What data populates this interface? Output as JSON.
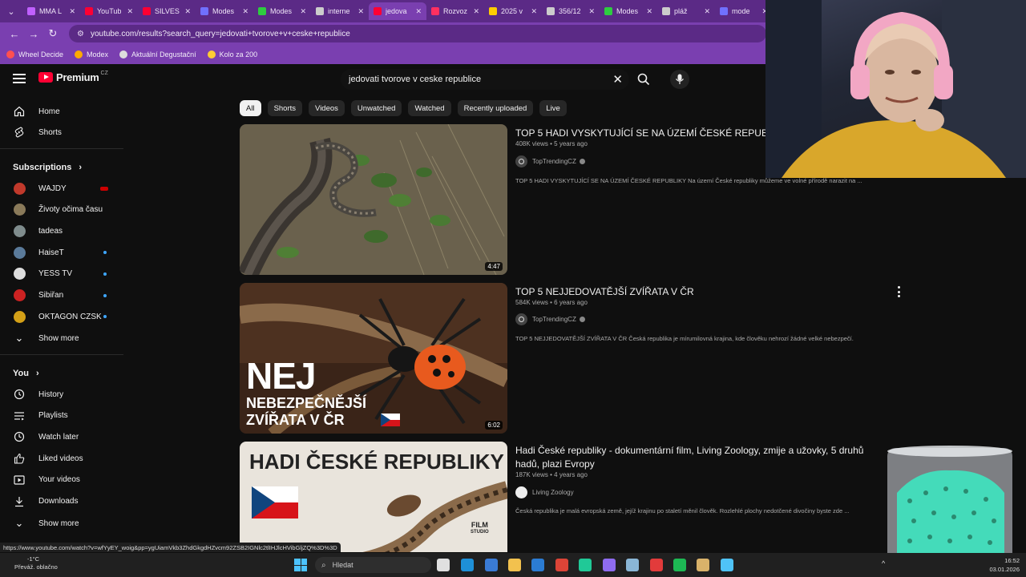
{
  "browser": {
    "tabs": [
      {
        "label": "MMA L",
        "color": "#c060ff"
      },
      {
        "label": "YouTub",
        "color": "#ff0033"
      },
      {
        "label": "SILVES",
        "color": "#ff0033"
      },
      {
        "label": "Modes",
        "color": "#7070ff"
      },
      {
        "label": "Modes",
        "color": "#2ecc40"
      },
      {
        "label": "interne",
        "color": "#cccccc"
      },
      {
        "label": "jedova",
        "color": "#ff0033",
        "active": true
      },
      {
        "label": "Rozvoz",
        "color": "#ff3060"
      },
      {
        "label": "2025 v",
        "color": "#ffcc00"
      },
      {
        "label": "356/12",
        "color": "#cccccc"
      },
      {
        "label": "Modes",
        "color": "#2ecc40"
      },
      {
        "label": "pláž",
        "color": "#cccccc"
      },
      {
        "label": "mode",
        "color": "#7070ff"
      }
    ],
    "url": "youtube.com/results?search_query=jedovati+tvorove+v+ceske+republice",
    "bookmarks": [
      {
        "label": "Wheel Decide",
        "color": "#ff5050"
      },
      {
        "label": "Modex",
        "color": "#ffaa00"
      },
      {
        "label": "Aktuální Degustační",
        "color": "#dddddd"
      },
      {
        "label": "Kolo za 200",
        "color": "#ffcc33"
      }
    ]
  },
  "youtube": {
    "logo_text": "Premium",
    "logo_country": "CZ",
    "search_value": "jedovati tvorove v ceske republice",
    "sidebar": {
      "main": [
        {
          "label": "Home",
          "icon": "home-icon"
        },
        {
          "label": "Shorts",
          "icon": "shorts-icon"
        }
      ],
      "subscriptions_title": "Subscriptions",
      "subscriptions": [
        {
          "label": "WAJDY",
          "color": "#c0392b",
          "badge": "live"
        },
        {
          "label": "Životy očima času",
          "color": "#8a7a5a",
          "badge": ""
        },
        {
          "label": "tadeas",
          "color": "#7f8c8d",
          "badge": ""
        },
        {
          "label": "HaiseT",
          "color": "#5a7a9a",
          "badge": "dot"
        },
        {
          "label": "YESS TV",
          "color": "#dddddd",
          "badge": "dot"
        },
        {
          "label": "Sibiřan",
          "color": "#cc2222",
          "badge": "dot"
        },
        {
          "label": "OKTAGON CZSK",
          "color": "#d4a017",
          "badge": "dot"
        }
      ],
      "show_more": "Show more",
      "you_title": "You",
      "you_items": [
        {
          "label": "History",
          "icon": "history-icon"
        },
        {
          "label": "Playlists",
          "icon": "playlists-icon"
        },
        {
          "label": "Watch later",
          "icon": "clock-icon"
        },
        {
          "label": "Liked videos",
          "icon": "thumbs-up-icon"
        },
        {
          "label": "Your videos",
          "icon": "video-icon"
        },
        {
          "label": "Downloads",
          "icon": "download-icon"
        }
      ],
      "show_more_2": "Show more"
    },
    "chips": [
      "All",
      "Shorts",
      "Videos",
      "Unwatched",
      "Watched",
      "Recently uploaded",
      "Live"
    ],
    "results": [
      {
        "title": "TOP 5 HADI VYSKYTUJÍCÍ SE NA ÚZEMÍ ČESKÉ REPUBLIKY",
        "meta": "408K views • 5 years ago",
        "channel": "TopTrendingCZ",
        "description": "TOP 5 HADI VYSKYTUJÍCÍ SE NA ÚZEMÍ ČESKÉ REPUBLIKY Na území České republiky můžeme ve volné přírodě narazit na ...",
        "duration": "4:47"
      },
      {
        "title": "TOP 5 NEJJEDOVATĚJŠÍ ZVÍŘATA V ČR",
        "meta": "584K views • 6 years ago",
        "channel": "TopTrendingCZ",
        "description": "TOP 5 NEJJEDOVATĚJŠÍ ZVÍŘATA V ČR Česká republika je mírumilovná krajina, kde člověku nehrozí žádné velké nebezpečí.",
        "duration": "6:02",
        "thumb_text_1": "NEJ",
        "thumb_text_2": "NEBEZPEČNĚJŠÍ",
        "thumb_text_3": "ZVÍŘATA V ČR"
      },
      {
        "title": "Hadi České republiky - dokumentární film, Living Zoology, zmije a užovky, 5 druhů hadů, plazi Evropy",
        "meta": "187K views • 4 years ago",
        "channel": "Living Zoology",
        "description": "Česká republika je malá evropská země, jejíž krajinu po staletí měnil člověk. Rozlehlé plochy nedotčené divočiny byste zde ...",
        "thumb_text_1": "HADI ČESKÉ REPUBLIKY",
        "thumb_badge_1": "FILM",
        "thumb_badge_2": "STUDIO"
      }
    ]
  },
  "status_url": "https://www.youtube.com/watch?v=wfYyEY_woig&pp=ygUiamVkb3ZhdGkgdHZvcm92ZSB2IGNlc2tlIHJlcHVibGljZQ%3D%3D",
  "taskbar": {
    "weather_temp": "-1°C",
    "weather_desc": "Převáž. oblačno",
    "search_placeholder": "Hledat",
    "time": "16:52",
    "date": "03.01.2026",
    "apps": [
      {
        "name": "task-view-icon",
        "color": "#e0e0e0"
      },
      {
        "name": "edge-icon",
        "color": "#1e90d8"
      },
      {
        "name": "store-icon",
        "color": "#3a7bd5"
      },
      {
        "name": "explorer-icon",
        "color": "#f2c14e"
      },
      {
        "name": "outlook-icon",
        "color": "#2b7cd3"
      },
      {
        "name": "chrome-icon",
        "color": "#db4437"
      },
      {
        "name": "app-icon",
        "color": "#20c997"
      },
      {
        "name": "discord-icon",
        "color": "#8e6cf0"
      },
      {
        "name": "steam-icon",
        "color": "#8ab6d6"
      },
      {
        "name": "opera-icon",
        "color": "#e23b3b"
      },
      {
        "name": "spotify-icon",
        "color": "#1db954"
      },
      {
        "name": "pen-icon",
        "color": "#d9b26a"
      },
      {
        "name": "notes-icon",
        "color": "#4fc3f7"
      }
    ]
  }
}
